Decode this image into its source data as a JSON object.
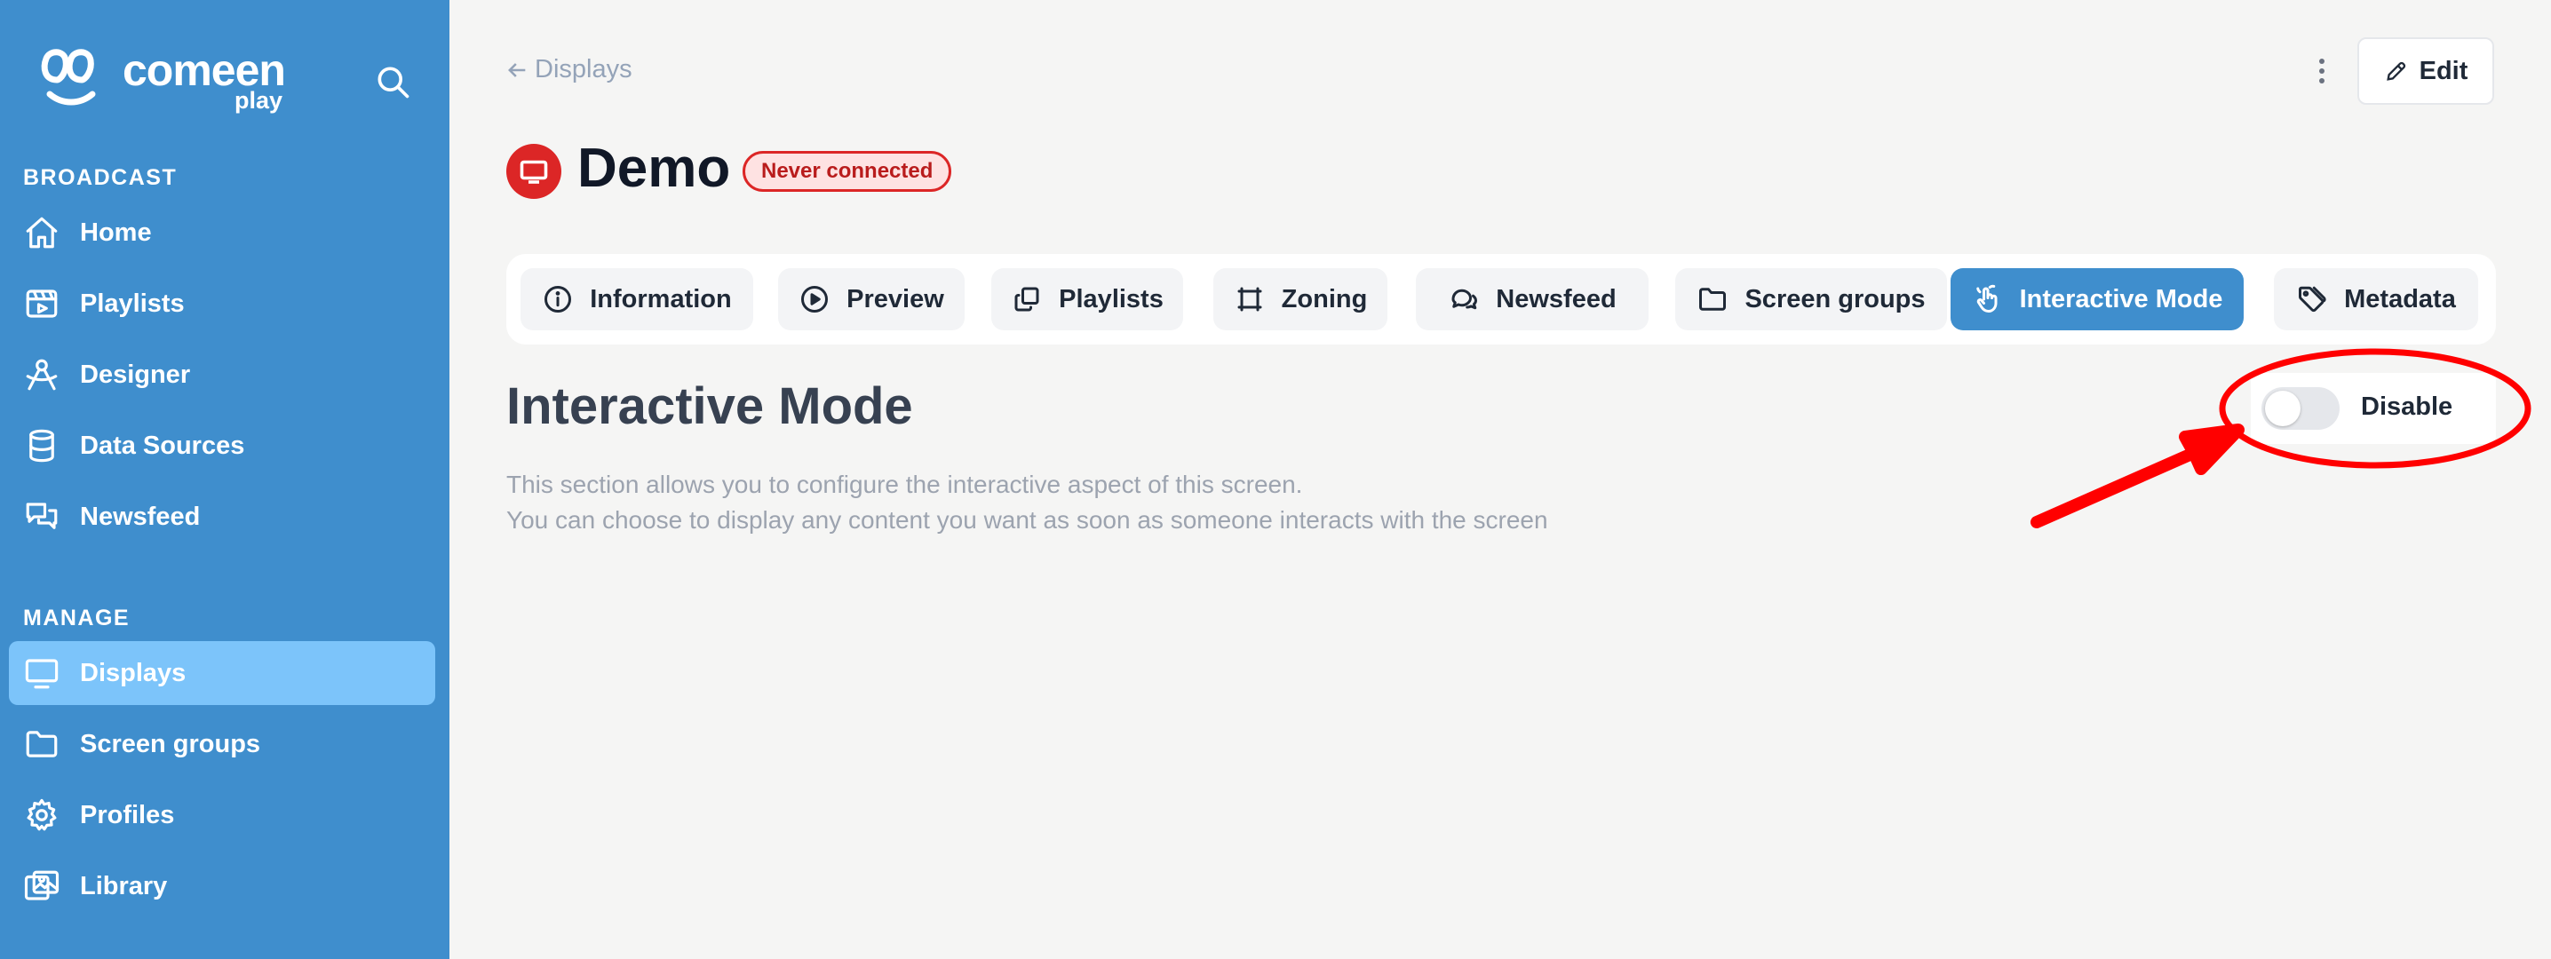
{
  "app": {
    "logo_text": "comeen",
    "logo_subtext": "play"
  },
  "sidebar": {
    "sections": [
      {
        "label": "BROADCAST",
        "items": [
          {
            "label": "Home",
            "icon": "home-icon"
          },
          {
            "label": "Playlists",
            "icon": "playlist-icon"
          },
          {
            "label": "Designer",
            "icon": "designer-icon"
          },
          {
            "label": "Data Sources",
            "icon": "database-icon"
          },
          {
            "label": "Newsfeed",
            "icon": "chat-icon"
          }
        ]
      },
      {
        "label": "MANAGE",
        "items": [
          {
            "label": "Displays",
            "icon": "monitor-icon",
            "active": true
          },
          {
            "label": "Screen groups",
            "icon": "folder-icon"
          },
          {
            "label": "Profiles",
            "icon": "gear-icon"
          },
          {
            "label": "Library",
            "icon": "images-icon"
          }
        ]
      }
    ]
  },
  "header": {
    "back_label": "Displays",
    "edit_label": "Edit",
    "title": "Demo",
    "status_badge": "Never connected"
  },
  "tabs": [
    {
      "label": "Information",
      "icon": "info-icon"
    },
    {
      "label": "Preview",
      "icon": "play-icon"
    },
    {
      "label": "Playlists",
      "icon": "copy-icon"
    },
    {
      "label": "Zoning",
      "icon": "zoning-icon"
    },
    {
      "label": "Newsfeed",
      "icon": "chat-icon"
    },
    {
      "label": "Screen groups",
      "icon": "folder-icon"
    },
    {
      "label": "Interactive Mode",
      "icon": "hand-icon",
      "active": true
    },
    {
      "label": "Metadata",
      "icon": "tag-icon"
    }
  ],
  "content": {
    "section_title": "Interactive Mode",
    "description_line1": "This section allows you to configure the interactive aspect of this screen.",
    "description_line2": "You can choose to display any content you want as soon as someone interacts with the screen",
    "toggle_label": "Disable",
    "toggle_on": false
  },
  "colors": {
    "sidebar": "#3f8ecd",
    "active_nav": "#7cc4fa",
    "active_tab": "#3f8ecd",
    "danger": "#dc2626",
    "annotation": "#ff0000"
  }
}
